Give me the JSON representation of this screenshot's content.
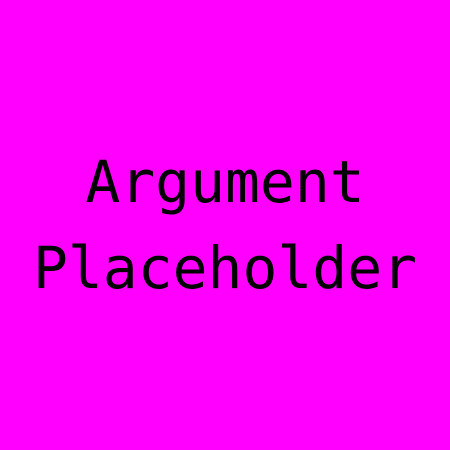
{
  "placeholder": {
    "line1": "Argument",
    "line2": "Placeholder"
  },
  "colors": {
    "background": "#ff00ff",
    "text": "#000000"
  }
}
